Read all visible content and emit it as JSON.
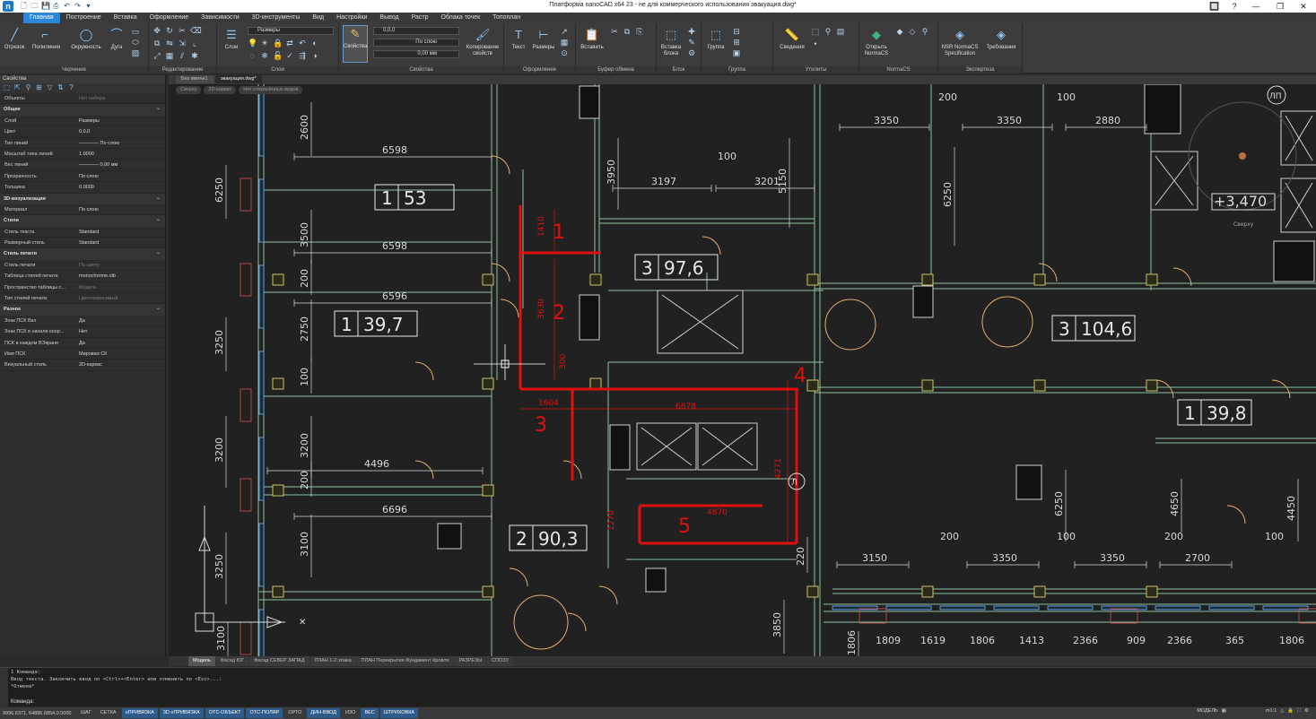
{
  "app": {
    "title": "Платформа nanoCAD x64 23 - не для коммерческого использования эвакуация.dwg*",
    "logo_letter": "n",
    "window_buttons": [
      "🔲",
      "?",
      "—",
      "❐",
      "✕"
    ]
  },
  "quick_access": [
    "🗋",
    "🗀",
    "💾",
    "⎙",
    "↶",
    "↷",
    "▾"
  ],
  "ribbon_tabs": [
    {
      "label": "Главная",
      "active": true
    },
    {
      "label": "Построение"
    },
    {
      "label": "Вставка"
    },
    {
      "label": "Оформление"
    },
    {
      "label": "Зависимости"
    },
    {
      "label": "3D-инструменты"
    },
    {
      "label": "Вид"
    },
    {
      "label": "Настройки"
    },
    {
      "label": "Вывод"
    },
    {
      "label": "Растр"
    },
    {
      "label": "Облака точек"
    },
    {
      "label": "Топоплан"
    }
  ],
  "ribbon_groups": {
    "drawing": {
      "label": "Черчение",
      "buttons": [
        "Отрезок",
        "Полилиния",
        "Окружность",
        "Дуга"
      ]
    },
    "edit": {
      "label": "Редактирование"
    },
    "layers": {
      "label": "Слои",
      "button": "Слои",
      "layer_combo": "Размеры"
    },
    "properties": {
      "label": "Свойства",
      "button": "Свойства",
      "color_combo": "0,0,0",
      "linetype_combo": "По слою",
      "lineweight_combo": "0,00 мм",
      "copy_button": "Копирование свойств"
    },
    "annotation": {
      "label": "Оформление",
      "buttons": [
        "Текст",
        "Размеры"
      ]
    },
    "clipboard": {
      "label": "Буфер обмена",
      "button": "Вставить"
    },
    "block": {
      "label": "Блок",
      "button": "Вставка блока"
    },
    "group": {
      "label": "Группа",
      "button": "Группа"
    },
    "utilities": {
      "label": "Утилиты",
      "button": "Сведения"
    },
    "normacs": {
      "label": "NormaCS",
      "button": "Открыть NormaCS"
    },
    "expertise": {
      "label": "Экспертиза",
      "buttons": [
        "NSR NormaCS Specification",
        "Требования"
      ]
    }
  },
  "properties_panel": {
    "title": "Свойства",
    "objects_label": "Объекты",
    "objects_value": "Нет набора",
    "sections": [
      {
        "name": "Общие",
        "rows": [
          {
            "k": "Слой",
            "v": "Размеры"
          },
          {
            "k": "Цвет",
            "v": "0,0,0"
          },
          {
            "k": "Тип линий",
            "v": "———— По слою"
          },
          {
            "k": "Масштаб типа линий",
            "v": "1.0000"
          },
          {
            "k": "Вес линий",
            "v": "———— 0,00 мм"
          },
          {
            "k": "Прозрачность",
            "v": "По слою"
          },
          {
            "k": "Толщина",
            "v": "0.0000"
          }
        ]
      },
      {
        "name": "3D-визуализация",
        "rows": [
          {
            "k": "Материал",
            "v": "По слою"
          }
        ]
      },
      {
        "name": "Стили",
        "rows": [
          {
            "k": "Стиль текста",
            "v": "Standard"
          },
          {
            "k": "Размерный стиль",
            "v": "Standard"
          }
        ]
      },
      {
        "name": "Стиль печати",
        "rows": [
          {
            "k": "Стиль печати",
            "v": "По цвету",
            "dim": true
          },
          {
            "k": "Таблица стилей печати",
            "v": "monochrome.ctb"
          },
          {
            "k": "Пространство таблицы с...",
            "v": "Модель",
            "dim": true
          },
          {
            "k": "Тип стилей печати",
            "v": "Цветозависимый",
            "dim": true
          }
        ]
      },
      {
        "name": "Разное",
        "rows": [
          {
            "k": "Знак ПСК Вкл",
            "v": "Да"
          },
          {
            "k": "Знак ПСК в начале коор...",
            "v": "Нет"
          },
          {
            "k": "ПСК в каждом ВЭкране",
            "v": "Да"
          },
          {
            "k": "Имя ПСК",
            "v": "Мировая СК"
          },
          {
            "k": "Визуальный стиль",
            "v": "2D-каркас"
          }
        ]
      }
    ]
  },
  "doc_tabs": [
    {
      "label": "Без имени1"
    },
    {
      "label": "эвакуация.dwg*",
      "active": true
    }
  ],
  "view_bar": [
    "Сверху",
    "2D-каркас",
    "Нет сохранённых видов"
  ],
  "drawing": {
    "room_labels": [
      {
        "num": "1",
        "area": "53"
      },
      {
        "num": "3",
        "area": "97,6"
      },
      {
        "num": "1",
        "area": "39,7"
      },
      {
        "num": "3",
        "area": "104,6"
      },
      {
        "num": "1",
        "area": "39,8"
      },
      {
        "num": "2",
        "area": "90,3"
      }
    ],
    "route_numbers": [
      "1",
      "2",
      "3",
      "4",
      "5"
    ],
    "route_dims": [
      "1410",
      "3630",
      "300",
      "1604",
      "6878",
      "4271",
      "4870",
      "1270"
    ],
    "dims": [
      "6598",
      "6598",
      "6596",
      "4496",
      "6696",
      "3197",
      "3201",
      "100",
      "3950",
      "5150",
      "200",
      "3350",
      "3350",
      "100",
      "2880",
      "6250",
      "2600",
      "3500",
      "200",
      "2750",
      "100",
      "3200",
      "200",
      "3100",
      "3250",
      "3250",
      "6250",
      "3200",
      "3150",
      "200",
      "3350",
      "100",
      "3350",
      "200",
      "2700",
      "100",
      "6250",
      "4650",
      "4450",
      "3850",
      "220",
      "1806",
      "1809",
      "1619",
      "1806",
      "1413",
      "2366",
      "909",
      "2366",
      "365",
      "1806",
      "3100"
    ],
    "level_mark": "+3,470",
    "compass_label": "Сверху",
    "axis_mark": "ЛП",
    "axis_mark2": "Л",
    "colors": {
      "route": "#e01010",
      "wall": "#8fbf9f",
      "dim": "#d8d8d8",
      "column": "#c9c36a",
      "door": "#e0b070",
      "window": "#5fa0e0"
    }
  },
  "layout_tabs": [
    {
      "label": "Модель",
      "active": true
    },
    {
      "label": "Фасад ЮГ"
    },
    {
      "label": "Фасад СЕВЕР ЗАПАД"
    },
    {
      "label": "ПЛАН 1-2 этажа"
    },
    {
      "label": "ПЛАН Перекрытия Фундамент Кровля"
    },
    {
      "label": "РАЗРЕЗЫ"
    },
    {
      "label": "СПОЗУ"
    }
  ],
  "command_line": {
    "lines": [
      "1 Команда:",
      "Ввод текста. Закончить ввод по <Ctrl>+<Enter> или отменить по <Esc>...:",
      "*Отмена*"
    ],
    "prompt": "Команда:"
  },
  "status_bar": {
    "coords": "9996.6371, 64886.6854,0.0000",
    "buttons": [
      {
        "label": "ШАГ"
      },
      {
        "label": "СЕТКА"
      },
      {
        "label": "оПРИВЯЗКА",
        "on": true
      },
      {
        "label": "3D оПРИВЯЗКА",
        "on": true
      },
      {
        "label": "ОТС-ОБЪЕКТ",
        "on": true
      },
      {
        "label": "ОТС-ПОЛЯР",
        "on": true
      },
      {
        "label": "ОРТО"
      },
      {
        "label": "ДИН-ВВОД",
        "on": true
      },
      {
        "label": "ИЗО"
      },
      {
        "label": "ВЕС",
        "on": true
      },
      {
        "label": "ШТРИХОВКА",
        "on": true
      }
    ],
    "model_label": "МОДЕЛЬ",
    "scale": "m1:1"
  }
}
